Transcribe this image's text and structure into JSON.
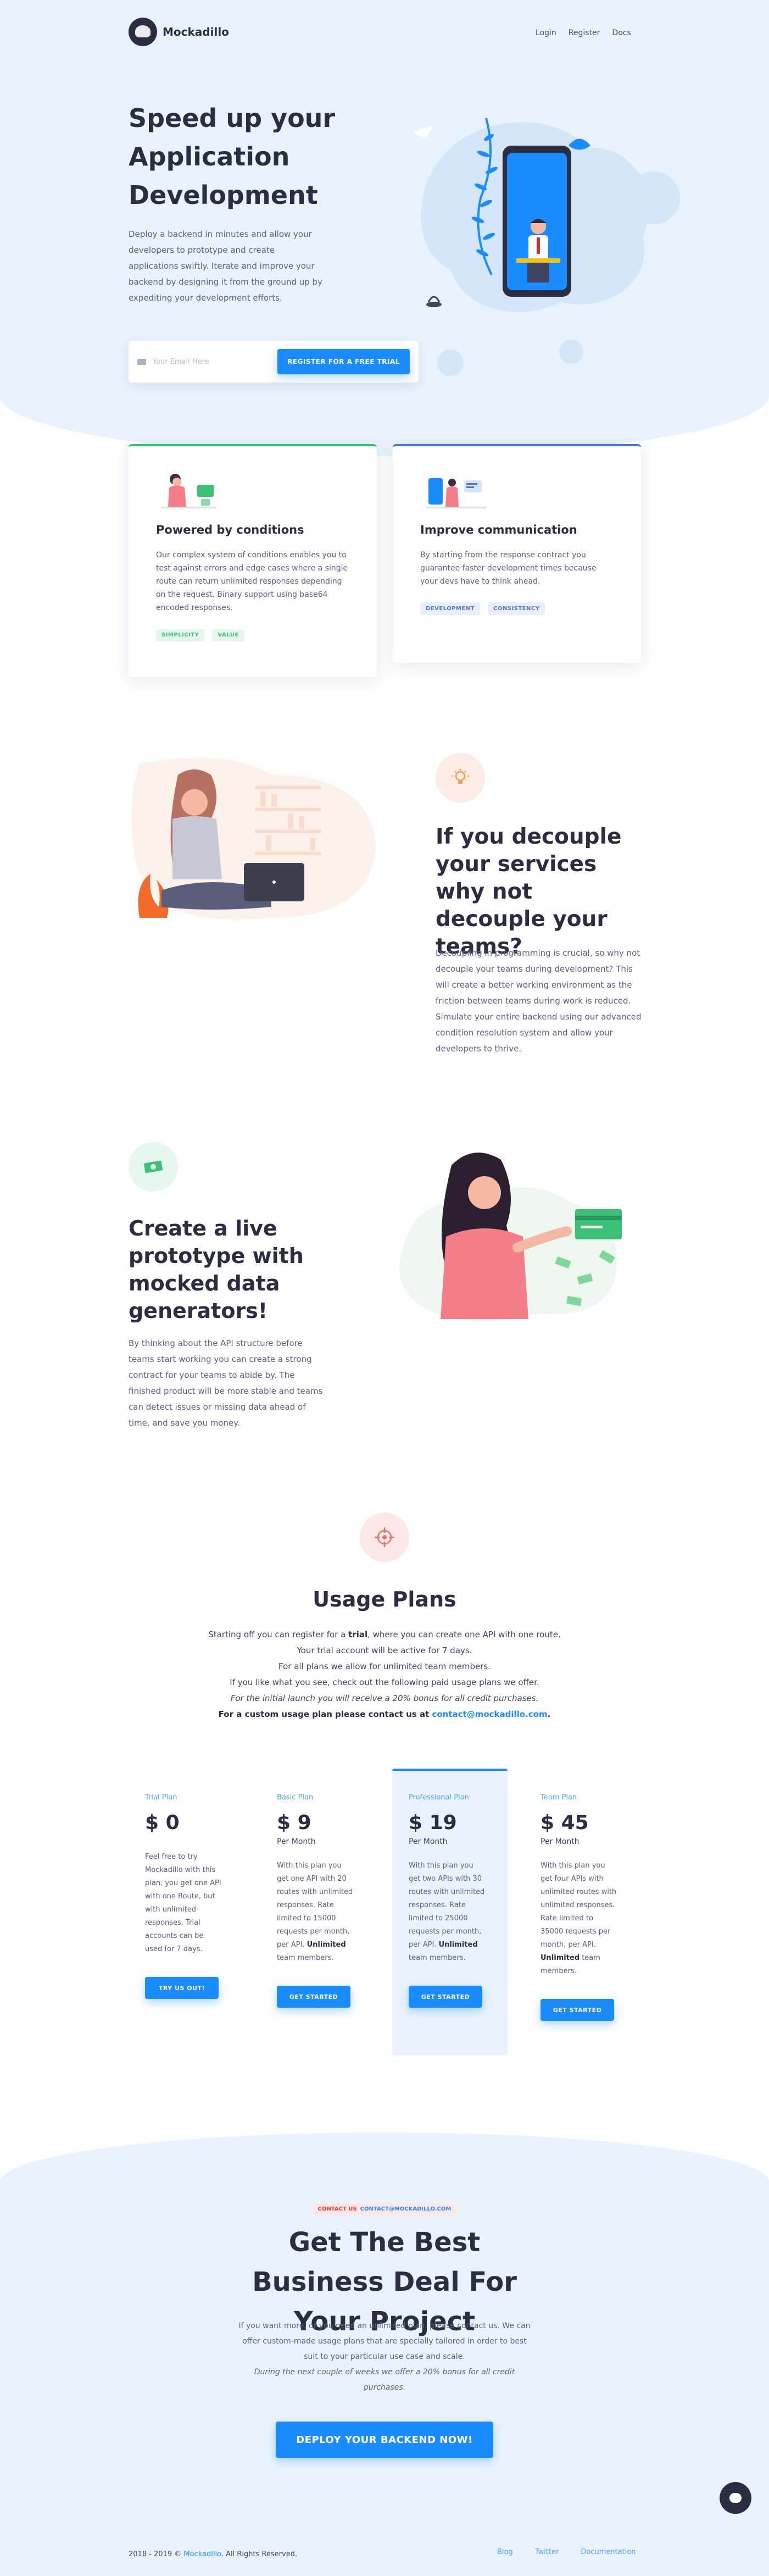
{
  "brand": {
    "name": "Mockadillo"
  },
  "nav": {
    "items": [
      "Login",
      "Register",
      "Docs"
    ]
  },
  "hero": {
    "title": "Speed up your Application Development",
    "text": "Deploy a backend in minutes and allow your developers to prototype and create applications swiftly. Iterate and improve your backend by designing it from the ground up by expediting your development efforts.",
    "email_placeholder": "Your Email Here",
    "cta": "REGISTER FOR A FREE TRIAL"
  },
  "features": [
    {
      "title": "Powered by conditions",
      "text": "Our complex system of conditions enables you to test against errors and edge cases where a single route can return unlimited responses depending on the request. Binary support using base64 encoded responses.",
      "tags": [
        "SIMPLICITY",
        "VALUE"
      ],
      "accent": "#3cc177"
    },
    {
      "title": "Improve communication",
      "text": "By starting from the response contract you guarantee faster development times because your devs have to think ahead.",
      "tags": [
        "DEVELOPMENT",
        "CONSISTENCY"
      ],
      "accent": "#4b74d6"
    }
  ],
  "decouple": {
    "icon": "lightbulb-icon",
    "title": "If you decouple your services why not decouple your teams?",
    "text": "Decoupling in programming is crucial, so why not decouple your teams during development? This will create a better working environment as the friction between teams during work is reduced. Simulate your entire backend using our advanced condition resolution system and allow your developers to thrive."
  },
  "prototype": {
    "icon": "money-icon",
    "title": "Create a live prototype with mocked data generators!",
    "text": "By thinking about the API structure before teams start working you can create a strong contract for your teams to abide by. The finished product will be more stable and teams can detect issues or missing data ahead of time, and save you money."
  },
  "pricing": {
    "icon": "target-icon",
    "title": "Usage Plans",
    "line1_pre": "Starting off you can register for a ",
    "line1_bold": "trial",
    "line1_post": ", where you can create one API with one route.",
    "line2": "Your trial account will be active for 7 days.",
    "line3": "For all plans we allow for unlimited team members.",
    "line4": "If you like what you see, check out the following paid usage plans we offer.",
    "line5": "For the initial launch you will receive a 20% bonus for all credit purchases.",
    "line6_pre": "For a custom usage plan please contact us at ",
    "line6_email": "contact@mockadillo.com",
    "line6_post": ".",
    "plans": [
      {
        "name": "Trial Plan",
        "price": "$ 0",
        "per": "",
        "desc_pre": "Feel free to try Mockadillo with this plan, you get one API with one Route, but with unlimited responses. Trial accounts can be used for 7 days.",
        "desc_bold": "",
        "desc_post": "",
        "button": "TRY US OUT!"
      },
      {
        "name": "Basic Plan",
        "price": "$ 9",
        "per": "Per Month",
        "desc_pre": "With this plan you get one API with 20 routes with unlimited responses. Rate limited to 15000 requests per month, per API. ",
        "desc_bold": "Unlimited",
        "desc_post": " team members.",
        "button": "GET STARTED"
      },
      {
        "name": "Professional Plan",
        "price": "$ 19",
        "per": "Per Month",
        "desc_pre": "With this plan you get two APIs with 30 routes with unlimited responses. Rate limited to 25000 requests per month, per API. ",
        "desc_bold": "Unlimited",
        "desc_post": " team members.",
        "button": "GET STARTED"
      },
      {
        "name": "Team Plan",
        "price": "$ 45",
        "per": "Per Month",
        "desc_pre": "With this plan you get four APIs with unlimited routes with unlimited responses. Rate limited to 35000 requests per month, per API. ",
        "desc_bold": "Unlimited",
        "desc_post": " team members.",
        "button": "GET STARTED"
      }
    ]
  },
  "business": {
    "badge_label": "CONTACT US",
    "badge_email": "CONTACT@MOCKADILLO.COM",
    "title": "Get The Best Business Deal For Your Project",
    "text": "If you want more, or you need an unlimited plan, please contact us. We can offer custom-made usage plans that are specially tailored in order to best suit to your particular use case and scale.",
    "italic": "During the next couple of weeks we offer a 20% bonus for all credit purchases.",
    "cta": "DEPLOY YOUR BACKEND NOW!"
  },
  "footer": {
    "copy_pre": "2018 - 2019 © ",
    "copy_brand": "Mockadillo",
    "copy_post": ". All Rights Reserved.",
    "links": [
      "Blog",
      "Twitter",
      "Documentation"
    ]
  },
  "chat": {
    "icon": "chat-bubble-icon"
  },
  "colors": {
    "primary": "#1a8cff",
    "heading": "#2b2d42",
    "hero_bg": "#eaf3fd",
    "green": "#3cc177",
    "blue": "#4b74d6"
  }
}
